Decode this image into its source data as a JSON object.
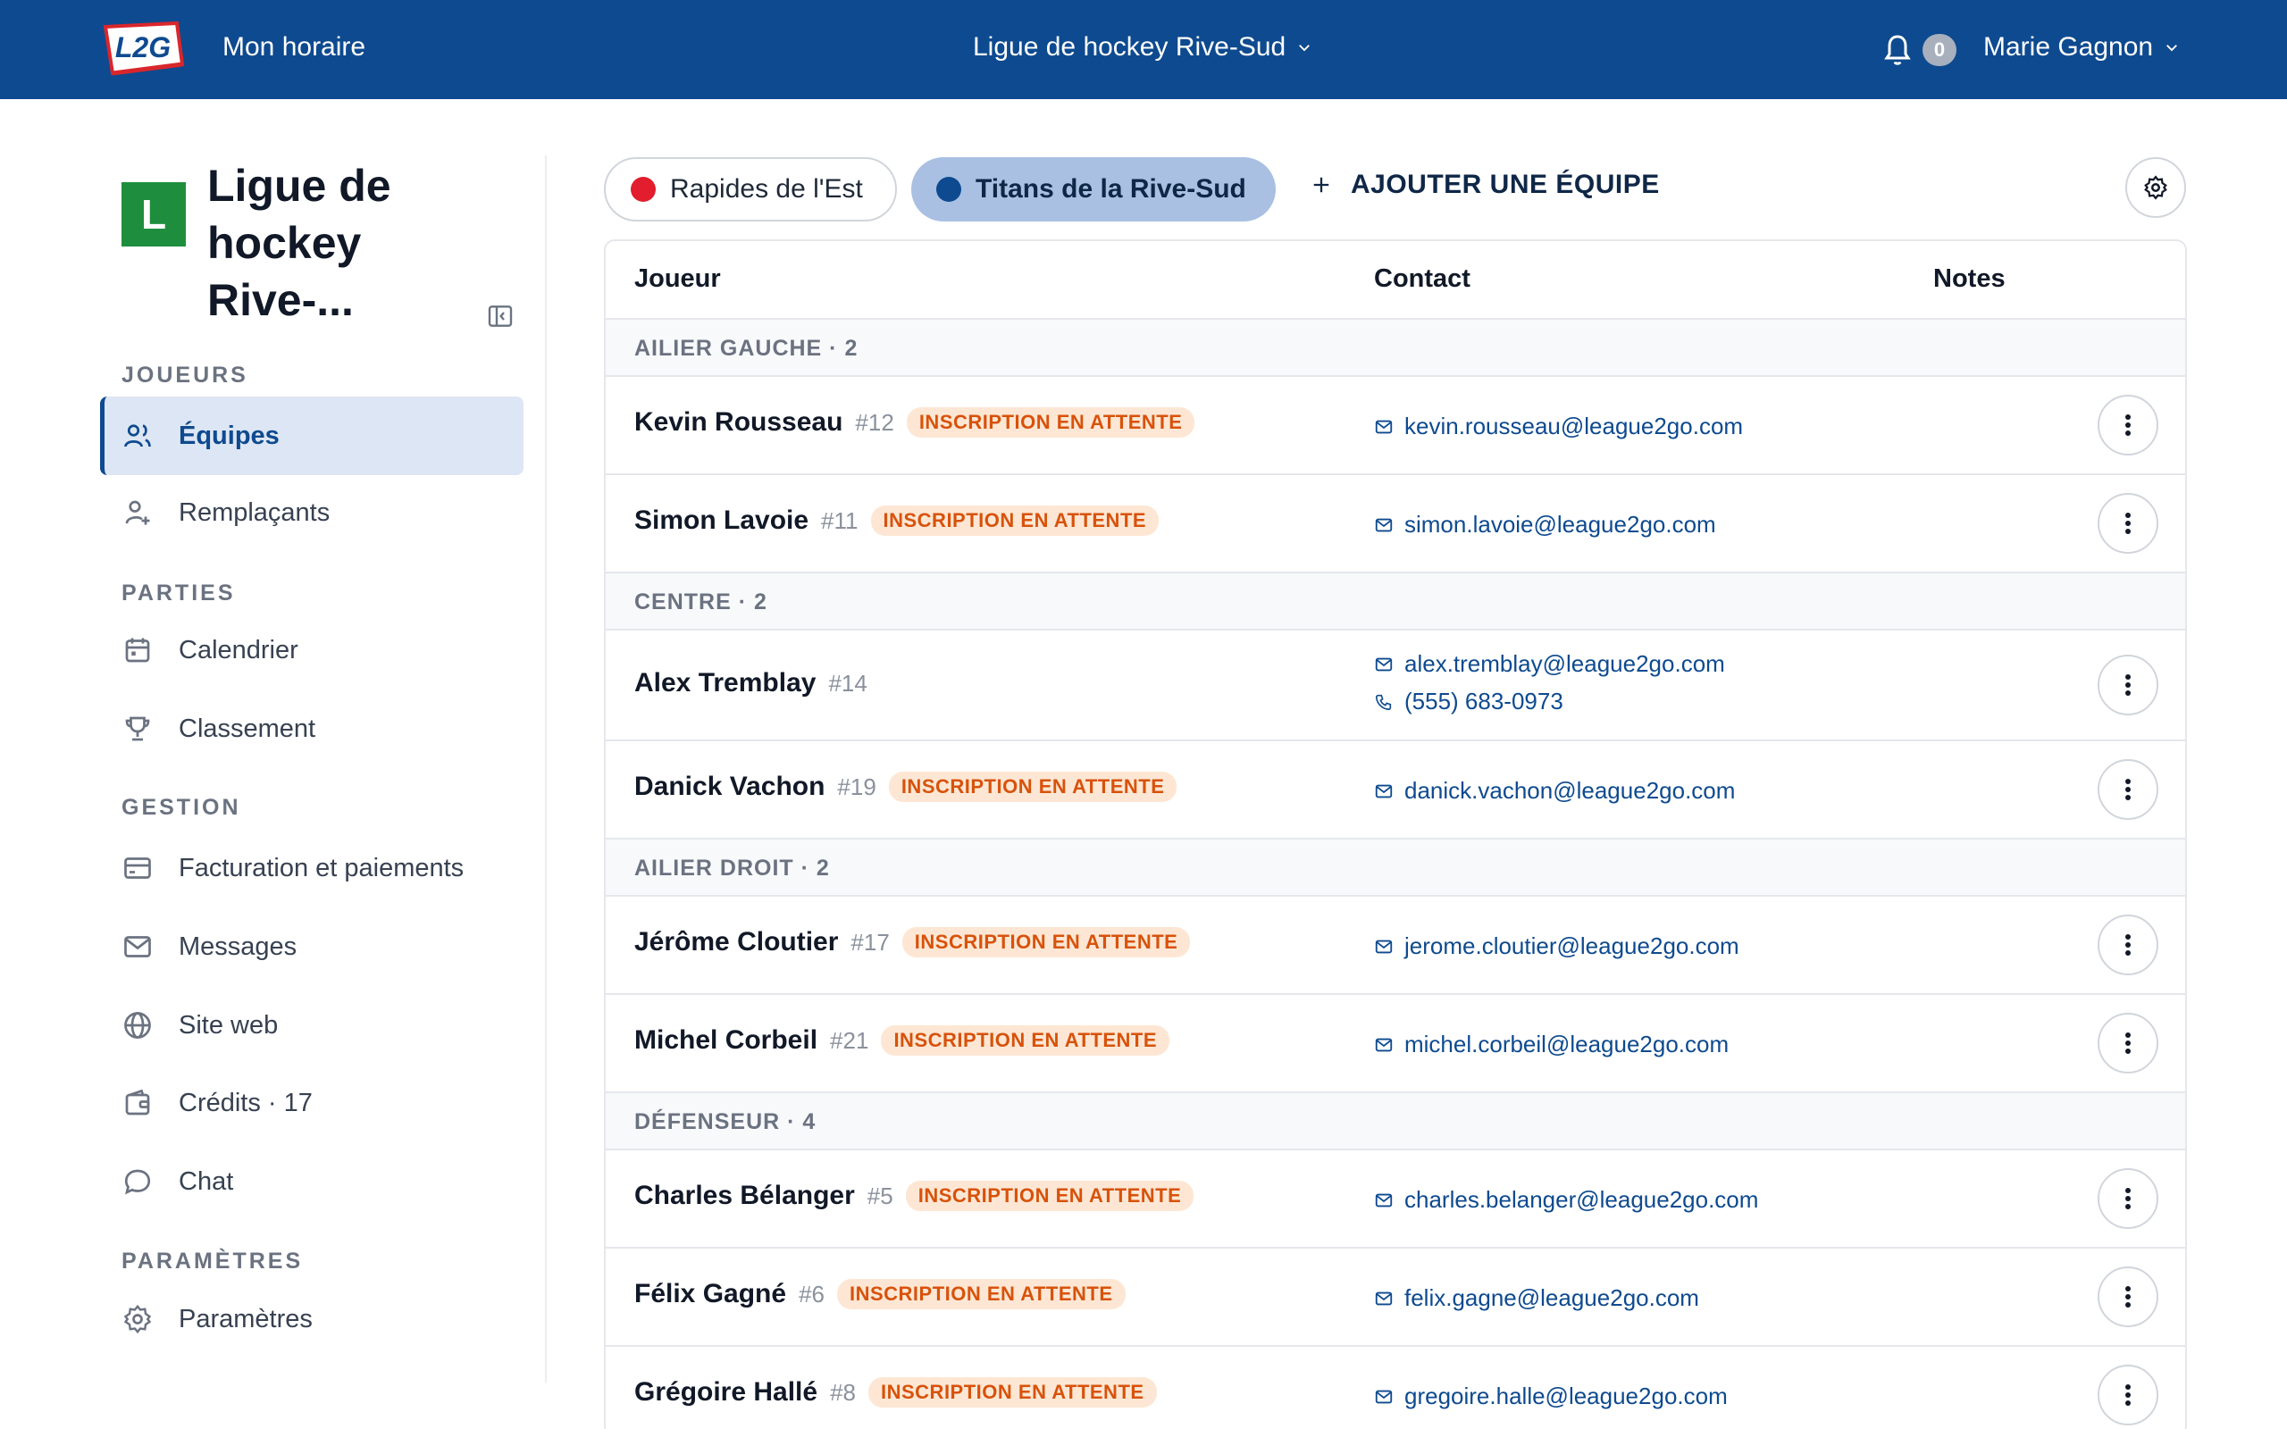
{
  "topbar": {
    "logo_text": "L2G",
    "schedule_link": "Mon horaire",
    "league_selector": "Ligue de hockey Rive-Sud",
    "notification_count": "0",
    "user_name": "Marie Gagnon",
    "background_color": "#0e4a8f"
  },
  "sidebar": {
    "league_initial": "L",
    "league_name": "Ligue de hockey Rive-...",
    "league_badge_color": "#1e8e3e",
    "sections": {
      "players": "JOUEURS",
      "games": "PARTIES",
      "management": "GESTION",
      "settings": "PARAMÈTRES"
    },
    "items": {
      "teams": "Équipes",
      "substitutes": "Remplaçants",
      "calendar": "Calendrier",
      "standings": "Classement",
      "billing": "Facturation et paiements",
      "messages": "Messages",
      "website": "Site web",
      "credits": "Crédits · 17",
      "chat": "Chat",
      "settings": "Paramètres"
    }
  },
  "team_tabs": [
    {
      "label": "Rapides de l'Est",
      "color": "#e11d2e",
      "selected": false
    },
    {
      "label": "Titans de la Rive-Sud",
      "color": "#0e4a8f",
      "selected": true
    }
  ],
  "add_team_label": "AJOUTER UNE ÉQUIPE",
  "table": {
    "headers": {
      "player": "Joueur",
      "contact": "Contact",
      "notes": "Notes"
    },
    "pending_label": "INSCRIPTION EN ATTENTE",
    "groups": [
      {
        "label": "AILIER GAUCHE · 2"
      },
      {
        "label": "CENTRE · 2"
      },
      {
        "label": "AILIER DROIT · 2"
      },
      {
        "label": "DÉFENSEUR · 4"
      }
    ],
    "players": [
      {
        "name": "Kevin Rousseau",
        "number": "#12",
        "status": "INSCRIPTION EN ATTENTE",
        "email": "kevin.rousseau@league2go.com"
      },
      {
        "name": "Simon Lavoie",
        "number": "#11",
        "status": "INSCRIPTION EN ATTENTE",
        "email": "simon.lavoie@league2go.com"
      },
      {
        "name": "Alex Tremblay",
        "number": "#14",
        "status": "",
        "email": "alex.tremblay@league2go.com",
        "phone": "(555) 683-0973"
      },
      {
        "name": "Danick Vachon",
        "number": "#19",
        "status": "INSCRIPTION EN ATTENTE",
        "email": "danick.vachon@league2go.com"
      },
      {
        "name": "Jérôme Cloutier",
        "number": "#17",
        "status": "INSCRIPTION EN ATTENTE",
        "email": "jerome.cloutier@league2go.com"
      },
      {
        "name": "Michel Corbeil",
        "number": "#21",
        "status": "INSCRIPTION EN ATTENTE",
        "email": "michel.corbeil@league2go.com"
      },
      {
        "name": "Charles Bélanger",
        "number": "#5",
        "status": "INSCRIPTION EN ATTENTE",
        "email": "charles.belanger@league2go.com"
      },
      {
        "name": "Félix Gagné",
        "number": "#6",
        "status": "INSCRIPTION EN ATTENTE",
        "email": "felix.gagne@league2go.com"
      },
      {
        "name": "Grégoire Hallé",
        "number": "#8",
        "status": "INSCRIPTION EN ATTENTE",
        "email": "gregoire.halle@league2go.com"
      }
    ]
  }
}
